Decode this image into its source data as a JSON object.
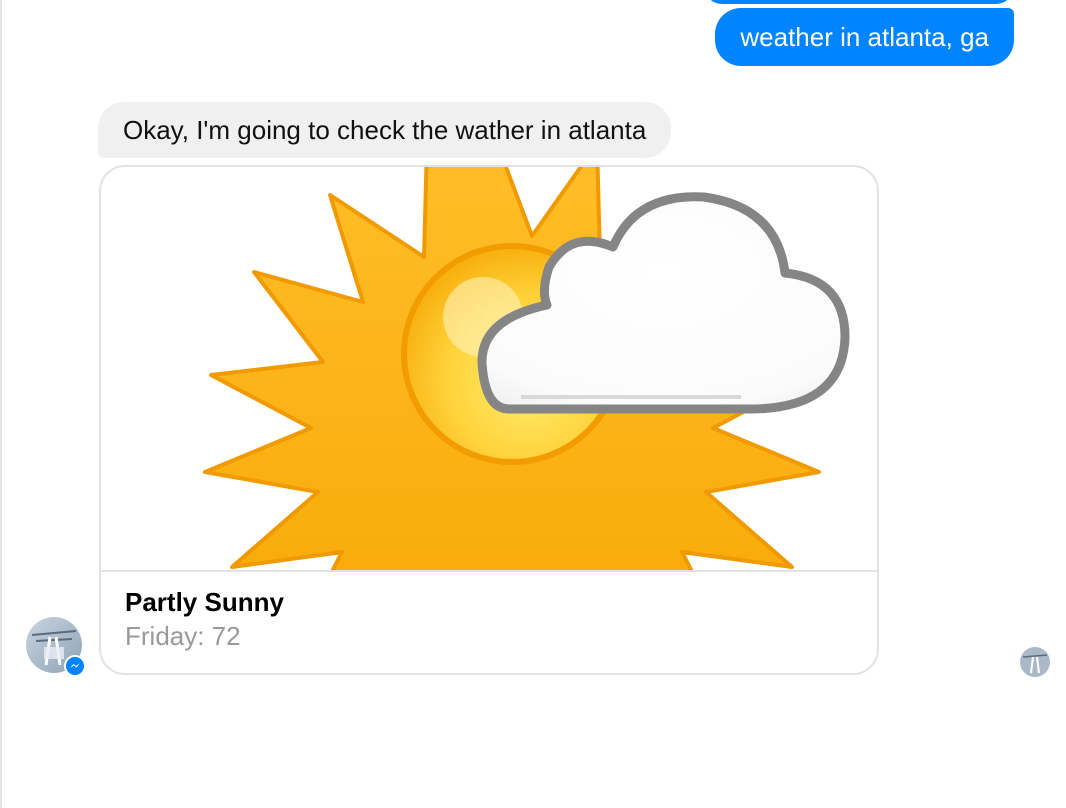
{
  "conversation": {
    "outgoing_message": "weather in atlanta, ga",
    "incoming_message": "Okay, I'm going to check the wather in atlanta"
  },
  "weather_card": {
    "icon": "partly-sunny-icon",
    "title": "Partly Sunny",
    "subtitle": "Friday: 72"
  },
  "colors": {
    "outgoing_bubble": "#0084ff",
    "incoming_bubble": "#f0f0f0",
    "sun_orange": "#f7a800",
    "sun_yellow": "#ffde55",
    "cloud_outline": "#8a8a8a",
    "card_border": "#e2e2e2",
    "subtitle_text": "#999999"
  },
  "icons": {
    "bot_avatar": "bot-avatar-icon",
    "messenger_badge": "messenger-badge-icon",
    "read_receipt": "read-receipt-avatar-icon"
  }
}
